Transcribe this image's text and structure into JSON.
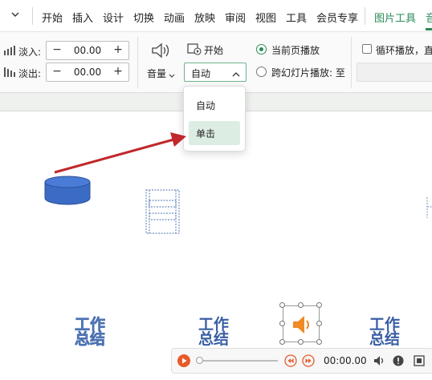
{
  "menubar": {
    "tabs": [
      "开始",
      "插入",
      "设计",
      "切换",
      "动画",
      "放映",
      "审阅",
      "视图",
      "工具",
      "会员专享",
      "图片工具",
      "音"
    ]
  },
  "ribbon": {
    "fade_in_label": "淡入:",
    "fade_in_value": "00.00",
    "fade_out_label": "淡出:",
    "fade_out_value": "00.00",
    "minus": "−",
    "plus": "+",
    "volume_label": "音量",
    "start_label": "开始",
    "start_dropdown_value": "自动",
    "current_page_play": "当前页播放",
    "cross_slide_play": "跨幻灯片播放: 至",
    "loop_play": "循环播放，直"
  },
  "dropdown_menu": {
    "options": [
      "自动",
      "单击"
    ],
    "highlighted": "单击"
  },
  "slide": {
    "wordart": [
      {
        "line1": "工作",
        "line2": "总结"
      },
      {
        "line1": "工作",
        "line2": "总结"
      },
      {
        "line1": "工作",
        "line2": "总结"
      }
    ]
  },
  "player": {
    "time": "00:00.00"
  },
  "colors": {
    "accent_green": "#2a8a57",
    "play_red": "#e85a2a",
    "arrow_red": "#c0282b",
    "shape_blue": "#3b6cc5"
  }
}
